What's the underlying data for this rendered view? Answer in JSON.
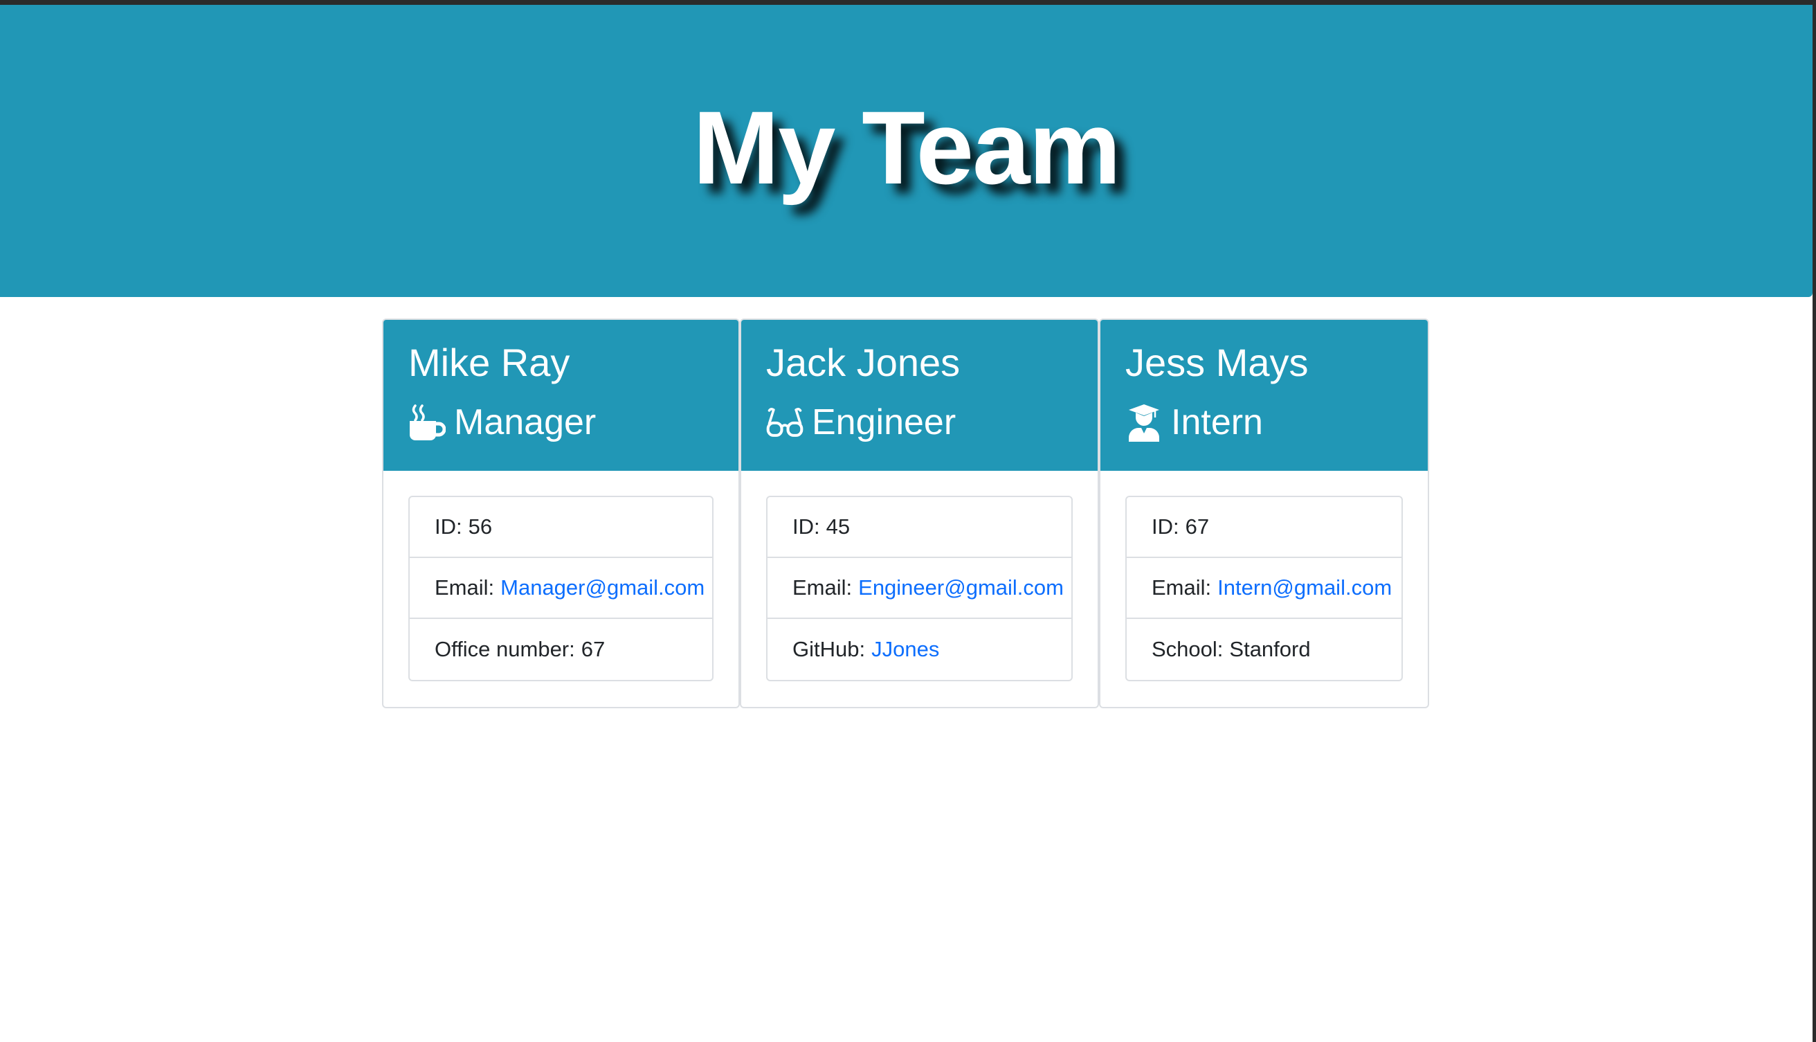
{
  "header": {
    "title": "My Team"
  },
  "team": [
    {
      "name": "Mike Ray",
      "role": "Manager",
      "icon": "coffee-mug-icon",
      "id_label": "ID:",
      "id": "56",
      "email_label": "Email:",
      "email": "Manager@gmail.com",
      "extra_label": "Office number:",
      "extra_value": "67"
    },
    {
      "name": "Jack Jones",
      "role": "Engineer",
      "icon": "glasses-icon",
      "id_label": "ID:",
      "id": "45",
      "email_label": "Email:",
      "email": "Engineer@gmail.com",
      "extra_label": "GitHub:",
      "extra_value": "JJones"
    },
    {
      "name": "Jess Mays",
      "role": "Intern",
      "icon": "graduate-icon",
      "id_label": "ID:",
      "id": "67",
      "email_label": "Email:",
      "email": "Intern@gmail.com",
      "extra_label": "School:",
      "extra_value": "Stanford"
    }
  ],
  "colors": {
    "header_bg": "#2197b6",
    "link": "#0d6efd",
    "text": "#212529",
    "border": "#dcdfe3"
  }
}
